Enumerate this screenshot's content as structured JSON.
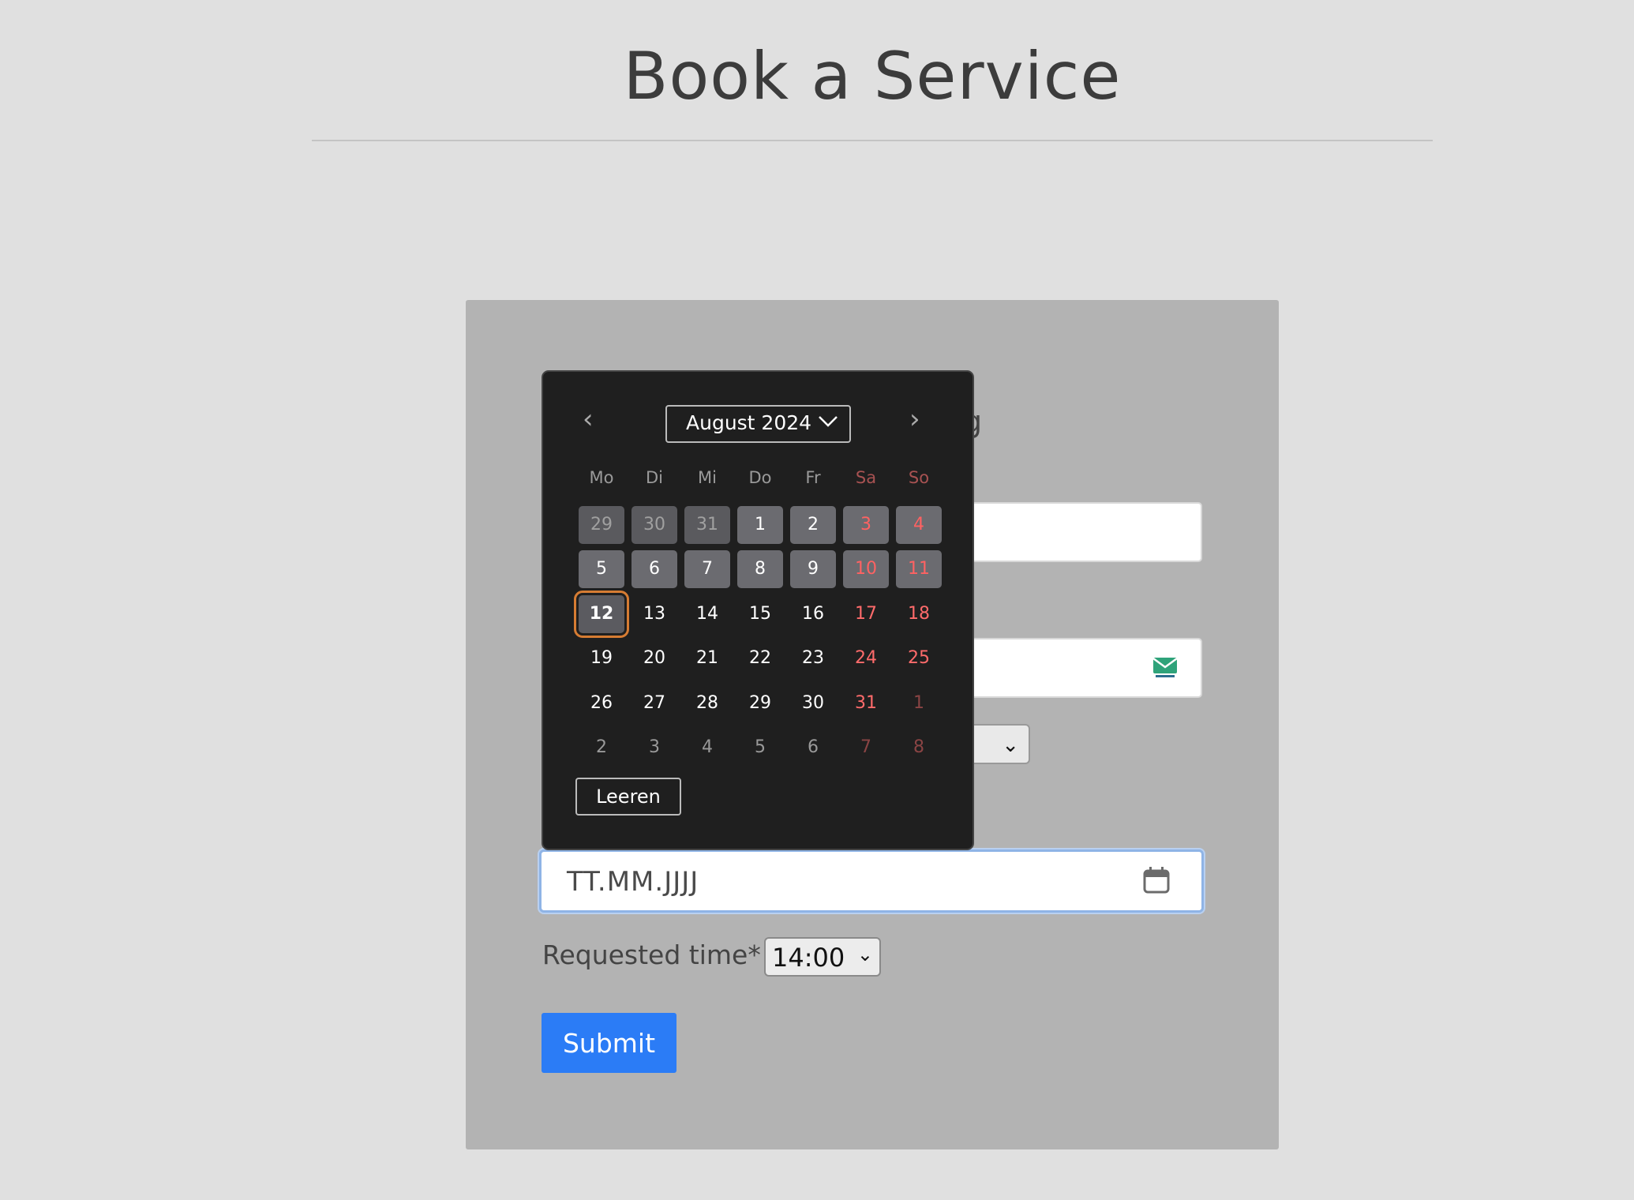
{
  "page": {
    "title": "Book a Service"
  },
  "form": {
    "heading_fragment": "g",
    "date_placeholder": "TT.MM.JJJJ",
    "time_label": "Requested time*",
    "time_value": "14:00",
    "submit_label": "Submit"
  },
  "calendar": {
    "month_label": "August 2024",
    "weekdays": [
      "Mo",
      "Di",
      "Mi",
      "Do",
      "Fr",
      "Sa",
      "So"
    ],
    "weeks": [
      [
        "29",
        "30",
        "31",
        "1",
        "2",
        "3",
        "4"
      ],
      [
        "5",
        "6",
        "7",
        "8",
        "9",
        "10",
        "11"
      ],
      [
        "12",
        "13",
        "14",
        "15",
        "16",
        "17",
        "18"
      ],
      [
        "19",
        "20",
        "21",
        "22",
        "23",
        "24",
        "25"
      ],
      [
        "26",
        "27",
        "28",
        "29",
        "30",
        "31",
        "1"
      ],
      [
        "2",
        "3",
        "4",
        "5",
        "6",
        "7",
        "8"
      ]
    ],
    "clear_label": "Leeren",
    "today": "12"
  },
  "icons": {
    "prev": "chevron-left-icon",
    "next": "chevron-right-icon",
    "calendar": "calendar-icon",
    "tempmail": "tempmail-icon"
  },
  "colors": {
    "submit": "#2b7cf6",
    "today_ring": "#d67c33",
    "weekend": "#ff6b6b"
  }
}
